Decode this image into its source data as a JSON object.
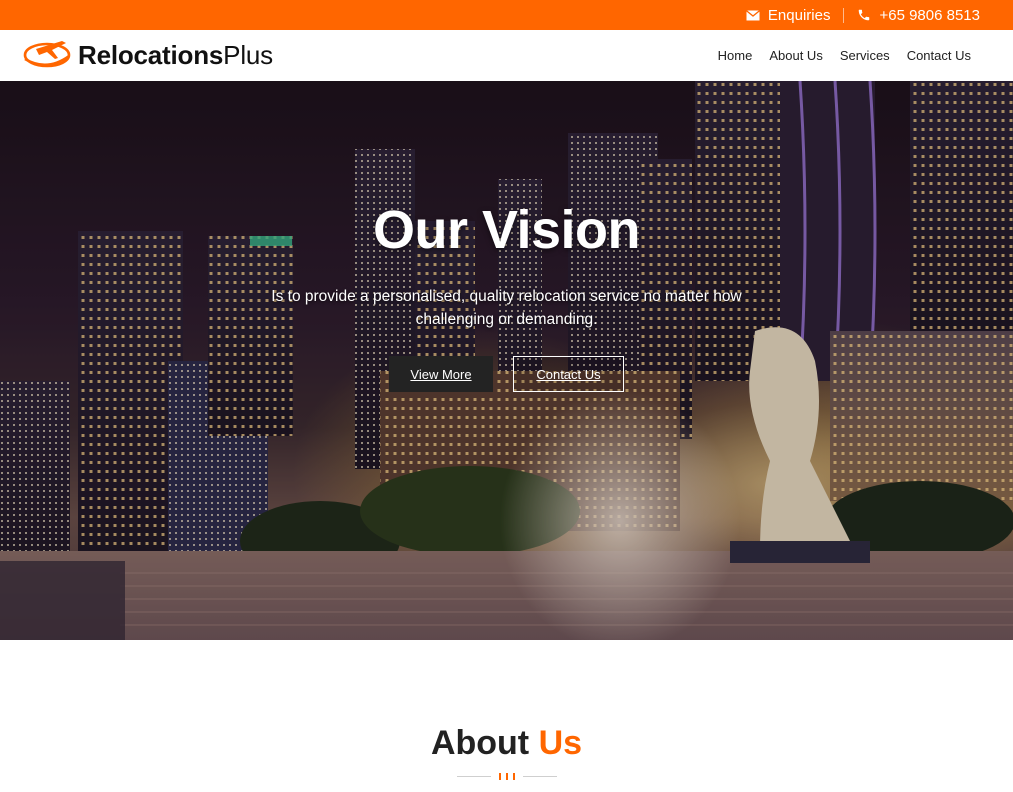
{
  "colors": {
    "accent": "#ff6600",
    "dark_button": "#232323"
  },
  "topbar": {
    "enquiries_icon": "envelope-icon",
    "enquiries_label": "Enquiries",
    "phone_icon": "phone-icon",
    "phone_number": "+65 9806 8513"
  },
  "header": {
    "logo_icon": "plane-swoosh-icon",
    "logo_bold": "Relocations",
    "logo_light": "Plus",
    "nav": [
      "Home",
      "About Us",
      "Services",
      "Contact Us"
    ]
  },
  "hero": {
    "title": "Our Vision",
    "subtitle": "Is to provide a personalised, quality relocation service no matter how challenging or demanding.",
    "primary_button": "View More",
    "secondary_button": "Contact Us"
  },
  "about": {
    "title_main": "About",
    "title_accent": "Us"
  }
}
